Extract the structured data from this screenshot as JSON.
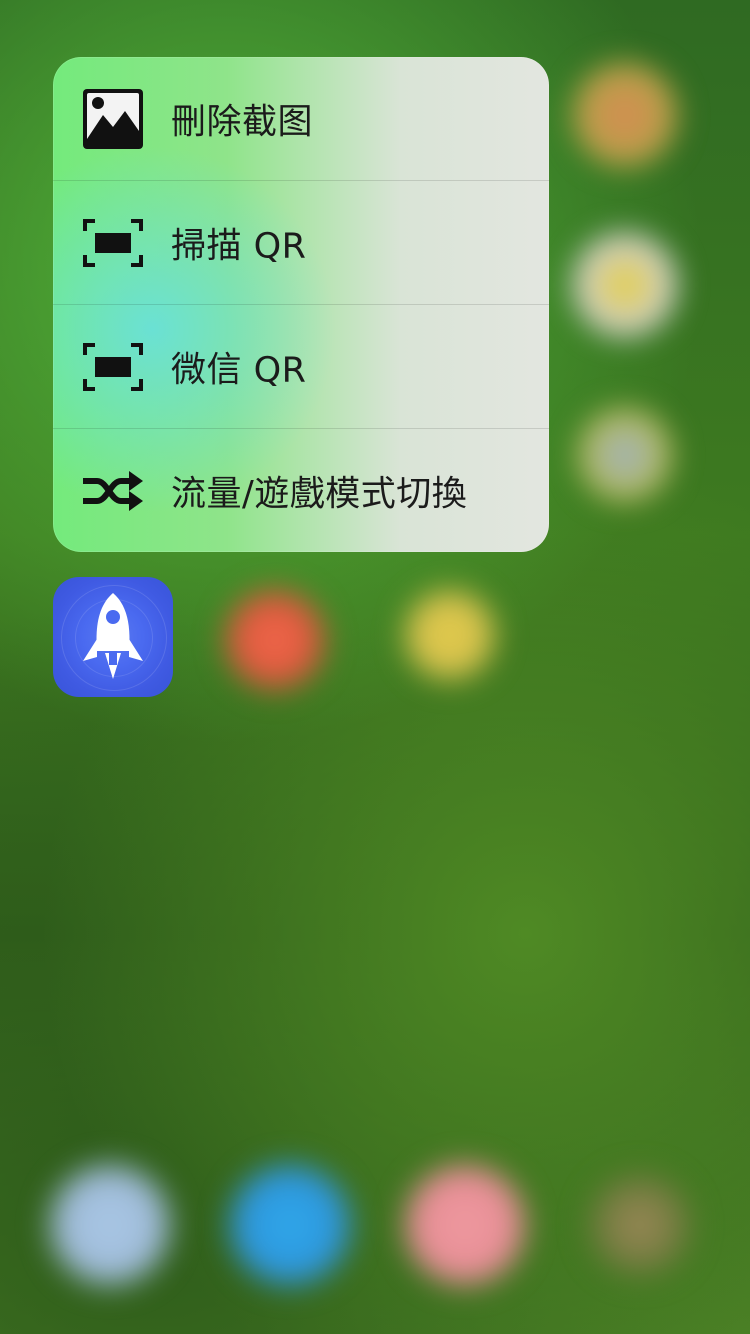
{
  "quick_actions": [
    {
      "label": "刪除截图",
      "icon": "image-icon"
    },
    {
      "label": "掃描 QR",
      "icon": "scan-qr-icon"
    },
    {
      "label": "微信 QR",
      "icon": "scan-qr-icon"
    },
    {
      "label": "流量/遊戲模式切換",
      "icon": "shuffle-icon"
    }
  ],
  "app": {
    "icon": "rocket-icon",
    "accent": "#4a6af0"
  },
  "colors": {
    "menu_text": "#1b1b1b",
    "icon": "#111111"
  }
}
